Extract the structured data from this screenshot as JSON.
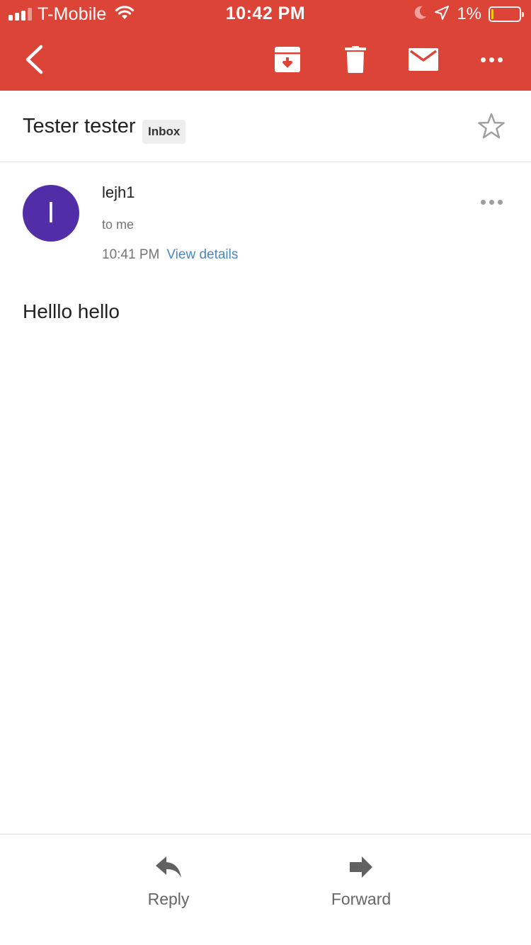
{
  "status_bar": {
    "carrier": "T-Mobile",
    "time": "10:42 PM",
    "battery_percent": "1%",
    "battery_level": 0.01,
    "icons": [
      "signal-icon",
      "wifi-icon",
      "moon-icon",
      "location-arrow-icon",
      "battery-icon"
    ]
  },
  "toolbar": {
    "icons": [
      "back-icon",
      "archive-icon",
      "trash-icon",
      "mail-icon",
      "more-icon"
    ]
  },
  "email": {
    "subject": "Tester tester",
    "label": "Inbox",
    "sender_initial": "l",
    "sender": "lejh1",
    "recipient": "to me",
    "time": "10:41 PM",
    "view_details": "View details",
    "body": "Helllo hello"
  },
  "actions": {
    "reply_label": "Reply",
    "forward_label": "Forward"
  },
  "colors": {
    "header": "#db4437",
    "avatar": "#512da8",
    "link": "#4a86c6"
  }
}
